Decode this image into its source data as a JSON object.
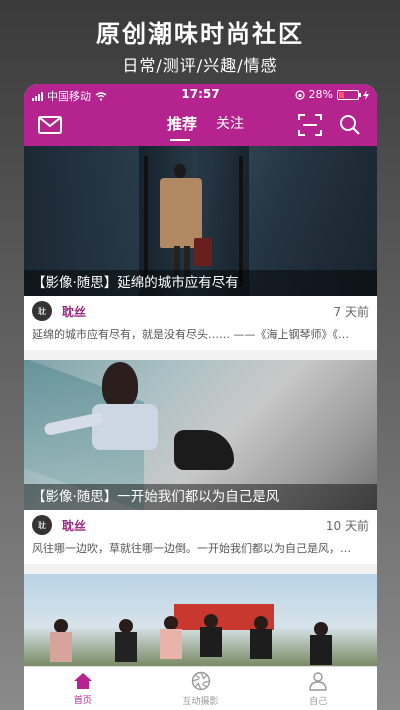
{
  "promo": {
    "title": "原创潮味时尚社区",
    "subtitle": "日常/测评/兴趣/情感"
  },
  "status_bar": {
    "carrier": "中国移动",
    "time": "17:57",
    "battery": "28%"
  },
  "header": {
    "tabs": [
      {
        "label": "推荐",
        "active": true
      },
      {
        "label": "关注",
        "active": false
      }
    ],
    "accent_color": "#b5238f"
  },
  "feed": [
    {
      "caption": "【影像·随思】延绵的城市应有尽有",
      "author": "耽丝",
      "avatar_text": "耽",
      "time": "7 天前",
      "excerpt": "延绵的城市应有尽有，就是没有尽头…… ——《海上钢琴师》《…"
    },
    {
      "caption": "【影像·随思】一开始我们都以为自己是风",
      "author": "耽丝",
      "avatar_text": "耽",
      "time": "10 天前",
      "excerpt": "风往哪一边吹，草就往哪一边倒。一开始我们都以为自己是风，…"
    }
  ],
  "bottom_nav": [
    {
      "label": "首页",
      "icon": "home-icon",
      "active": true
    },
    {
      "label": "互动摄影",
      "icon": "aperture-icon",
      "active": false
    },
    {
      "label": "自己",
      "icon": "user-icon",
      "active": false
    }
  ]
}
